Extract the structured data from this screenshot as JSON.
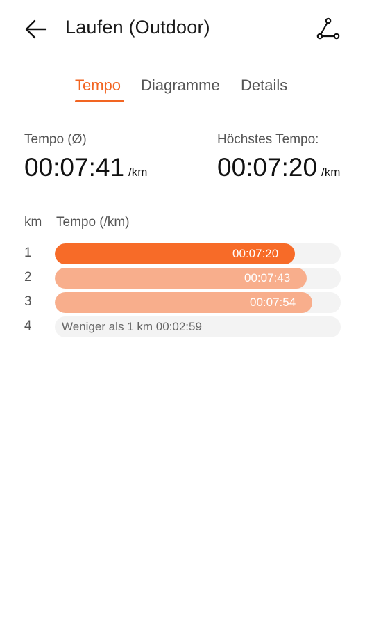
{
  "header": {
    "title": "Laufen (Outdoor)",
    "back_icon": "arrow-left-icon",
    "route_icon": "route-icon"
  },
  "tabs": [
    {
      "label": "Tempo",
      "active": true
    },
    {
      "label": "Diagramme",
      "active": false
    },
    {
      "label": "Details",
      "active": false
    }
  ],
  "stats": {
    "avg": {
      "label": "Tempo (Ø)",
      "value": "00:07:41",
      "unit": "/km"
    },
    "best": {
      "label": "Höchstes Tempo:",
      "value": "00:07:20",
      "unit": "/km"
    }
  },
  "table": {
    "col_km": "km",
    "col_pace": "Tempo (/km)",
    "rows": [
      {
        "km": "1",
        "time": "00:07:20",
        "fraction": 0.84,
        "highlight": true
      },
      {
        "km": "2",
        "time": "00:07:43",
        "fraction": 0.88,
        "highlight": false
      },
      {
        "km": "3",
        "time": "00:07:54",
        "fraction": 0.9,
        "highlight": false
      }
    ],
    "partial": {
      "km": "4",
      "text": "Weniger als 1 km 00:02:59"
    }
  },
  "colors": {
    "accent": "#f26522",
    "bar_best": "#f76b28",
    "bar_normal": "#f8ae8c",
    "track": "#f3f3f3"
  }
}
